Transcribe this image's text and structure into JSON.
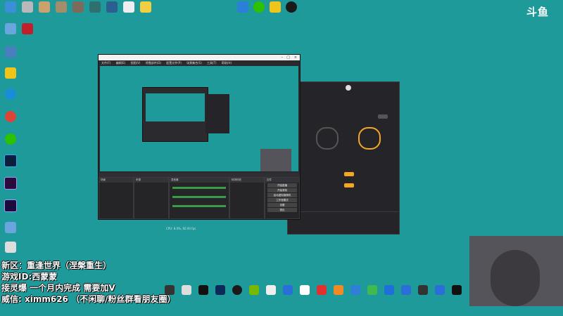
{
  "overlay": {
    "line1": "新区：重逢世界（涅槃重生）",
    "line2": "游戏ID:西蒙蒙",
    "line3": "接灵爆 一个月内完成 需要加V",
    "line4": "威信: ximm626 （不闲聊/粉丝群看朋友圈）"
  },
  "watermark": {
    "logo_text": "斗鱼"
  },
  "obs": {
    "menu": [
      "文件(F)",
      "编辑(E)",
      "视图(V)",
      "停靠部件(D)",
      "配置文件(P)",
      "场景集合(S)",
      "工具(T)",
      "帮助(H)"
    ],
    "docks": {
      "scenes": "场景",
      "sources": "来源",
      "mixer": "混音器",
      "transitions": "转场特效",
      "controls": "控件"
    },
    "controls": [
      "开始直播",
      "开始录制",
      "启动虚拟摄像机",
      "工作室模式",
      "设置",
      "退出"
    ],
    "status_text": "CPU: 8.0%, 60.00 fps"
  },
  "colors": {
    "desktop": "#1f9a9a",
    "obs_bg": "#2b2b2f",
    "accent": "#f5a623"
  }
}
